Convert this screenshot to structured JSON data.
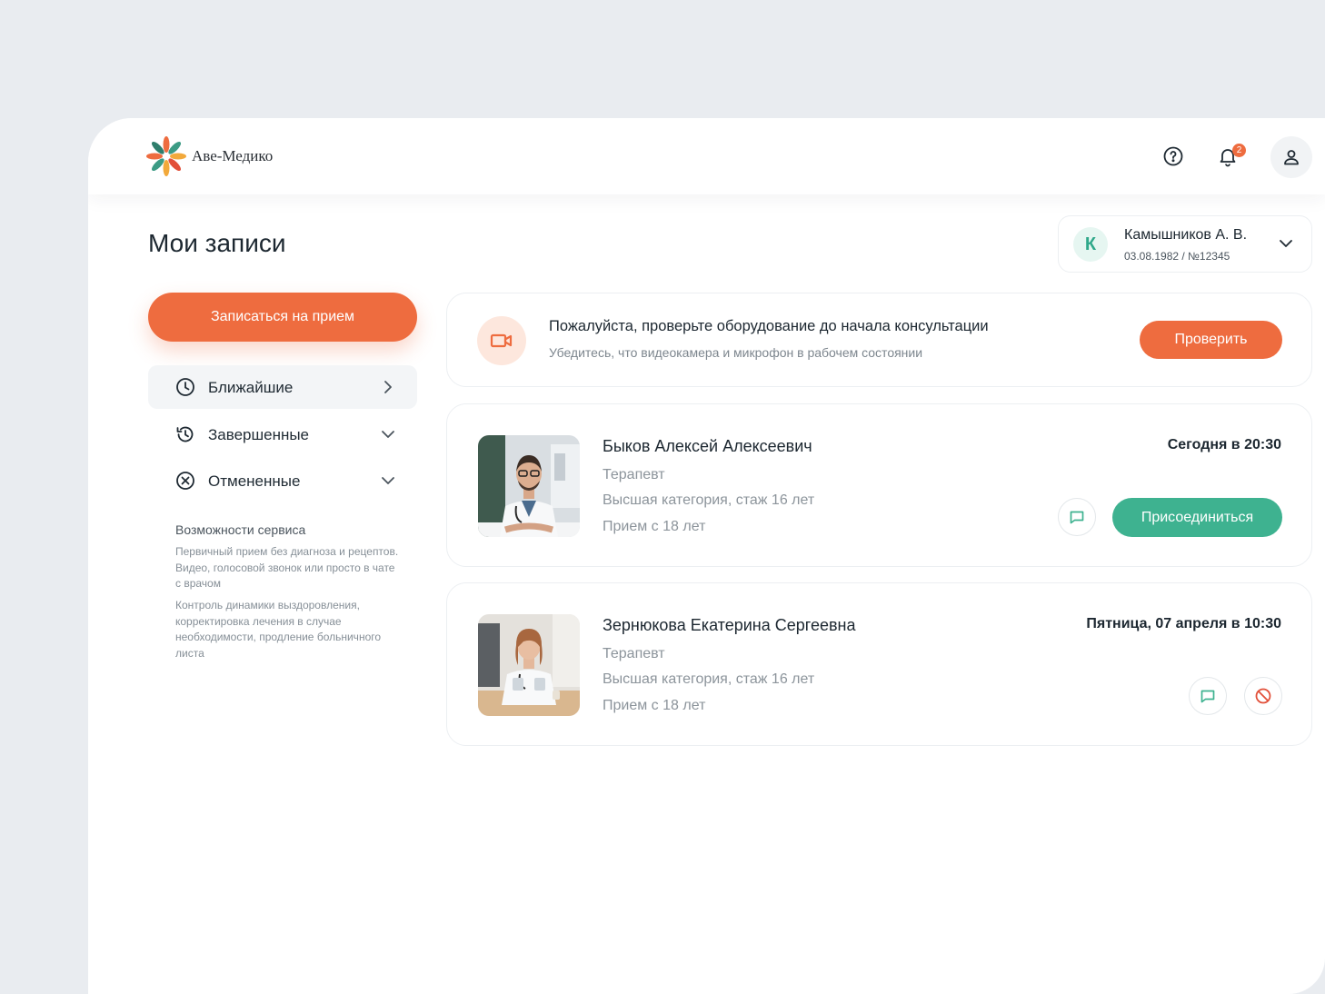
{
  "brand": {
    "name": "Аве-Медико"
  },
  "header": {
    "notifications_count": "2"
  },
  "page": {
    "title": "Мои записи"
  },
  "patient": {
    "initial": "К",
    "name": "Камышников А. В.",
    "details": "03.08.1982 / №12345"
  },
  "sidebar": {
    "book_label": "Записаться на прием",
    "items": [
      {
        "label": "Ближайшие",
        "icon": "clock-icon"
      },
      {
        "label": "Завершенные",
        "icon": "history-icon"
      },
      {
        "label": "Отмененные",
        "icon": "cancel-circle-icon"
      }
    ],
    "service": {
      "title": "Возможности сервиса",
      "text1": "Первичный прием без диагноза и рецептов. Видео, голосовой звонок или просто в чате с врачом",
      "text2": "Контроль динамики выздоровления, корректировка лечения в случае необходимости, продление больничного листа"
    }
  },
  "equipment_check": {
    "title": "Пожалуйста, проверьте оборудование до начала консультации",
    "subtitle": "Убедитесь, что видеокамера и микрофон в рабочем состоянии",
    "button": "Проверить"
  },
  "appointments": [
    {
      "doctor": "Быков Алексей Алексеевич",
      "specialty": "Терапевт",
      "category": "Высшая категория, стаж 16 лет",
      "age": "Прием с 18 лет",
      "time": "Сегодня в 20:30",
      "join_label": "Присоединиться"
    },
    {
      "doctor": "Зернюкова Екатерина Сергеевна",
      "specialty": "Терапевт",
      "category": "Высшая категория, стаж 16 лет",
      "age": "Прием с 18 лет",
      "time": "Пятница, 07 апреля в 10:30"
    }
  ],
  "colors": {
    "accent_orange": "#ee6c3f",
    "accent_green": "#3eb290",
    "background": "#e9ecf0"
  }
}
